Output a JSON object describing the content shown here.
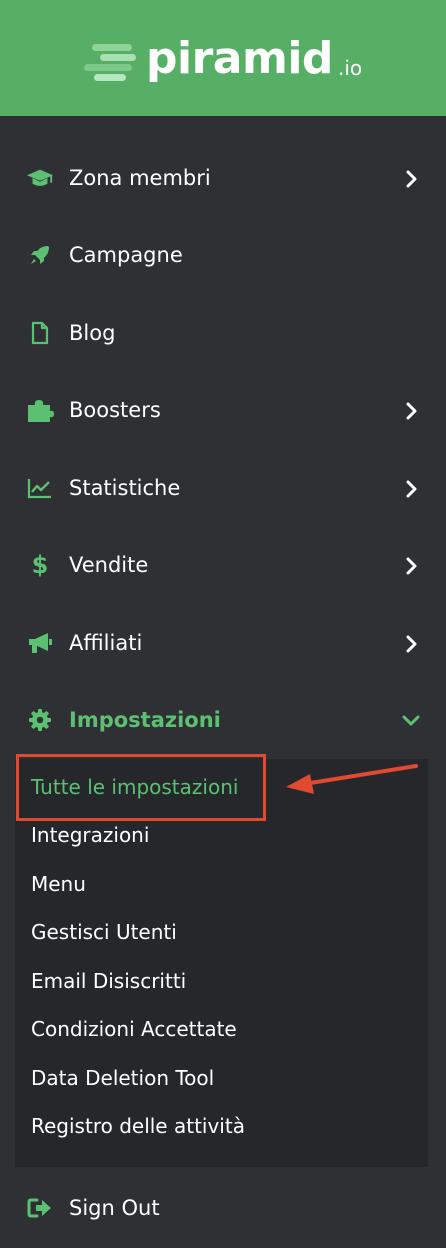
{
  "brand": {
    "name": "piramid",
    "suffix": ".io"
  },
  "colors": {
    "accent": "#5cc073",
    "header_bg": "#57ae65",
    "sidebar_bg": "#2f3034",
    "submenu_bg": "#26272b",
    "annotation": "#e04a30"
  },
  "menu": {
    "items": [
      {
        "label": "Zona membri",
        "icon": "graduation-cap-icon",
        "has_chevron": true
      },
      {
        "label": "Campagne",
        "icon": "rocket-icon",
        "has_chevron": false
      },
      {
        "label": "Blog",
        "icon": "file-icon",
        "has_chevron": false
      },
      {
        "label": "Boosters",
        "icon": "puzzle-icon",
        "has_chevron": true
      },
      {
        "label": "Statistiche",
        "icon": "line-chart-icon",
        "has_chevron": true
      },
      {
        "label": "Vendite",
        "icon": "dollar-icon",
        "has_chevron": true
      },
      {
        "label": "Affiliati",
        "icon": "megaphone-icon",
        "has_chevron": true
      },
      {
        "label": "Impostazioni",
        "icon": "gear-icon",
        "has_chevron": true,
        "expanded": true,
        "active": true
      }
    ],
    "submenu": [
      {
        "label": "Tutte le impostazioni",
        "active": true
      },
      {
        "label": "Integrazioni"
      },
      {
        "label": "Menu"
      },
      {
        "label": "Gestisci Utenti"
      },
      {
        "label": "Email Disiscritti"
      },
      {
        "label": "Condizioni Accettate"
      },
      {
        "label": "Data Deletion Tool"
      },
      {
        "label": "Registro delle attività"
      }
    ],
    "signout": {
      "label": "Sign Out",
      "icon": "sign-out-icon"
    }
  }
}
